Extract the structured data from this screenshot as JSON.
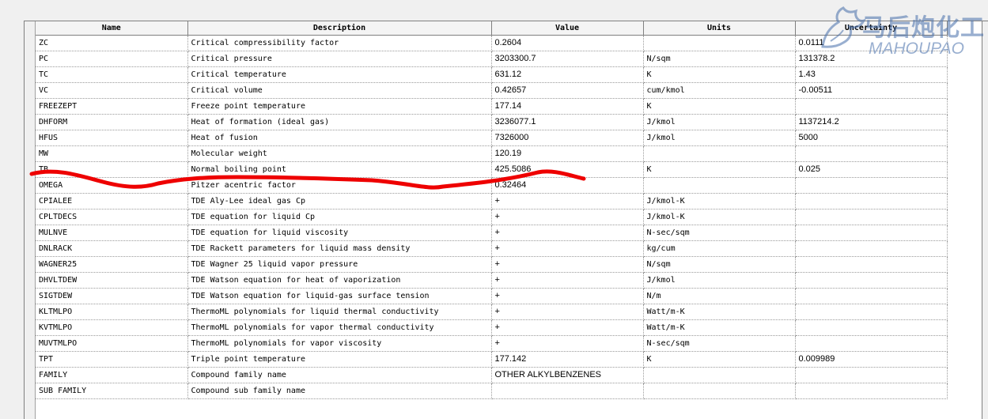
{
  "table": {
    "headers": [
      "Name",
      "Description",
      "Value",
      "Units",
      "Uncertainty"
    ],
    "rows": [
      [
        "ZC",
        "Critical compressibility factor",
        "0.2604",
        "",
        "0.0111"
      ],
      [
        "PC",
        "Critical pressure",
        "3203300.7",
        "N/sqm",
        "131378.2"
      ],
      [
        "TC",
        "Critical temperature",
        "631.12",
        "K",
        "1.43"
      ],
      [
        "VC",
        "Critical volume",
        "0.42657",
        "cum/kmol",
        "-0.00511"
      ],
      [
        "FREEZEPT",
        "Freeze point temperature",
        "177.14",
        "K",
        ""
      ],
      [
        "DHFORM",
        "Heat of formation (ideal gas)",
        "3236077.1",
        "J/kmol",
        "1137214.2"
      ],
      [
        "HFUS",
        "Heat of fusion",
        "7326000",
        "J/kmol",
        "5000"
      ],
      [
        "MW",
        "Molecular weight",
        "120.19",
        "",
        ""
      ],
      [
        "TB",
        "Normal boiling point",
        "425.5086",
        "K",
        "0.025"
      ],
      [
        "OMEGA",
        "Pitzer acentric factor",
        "0.32464",
        "",
        ""
      ],
      [
        "CPIALEE",
        "TDE Aly-Lee ideal gas Cp",
        "+",
        "J/kmol-K",
        ""
      ],
      [
        "CPLTDECS",
        "TDE equation for liquid Cp",
        "+",
        "J/kmol-K",
        ""
      ],
      [
        "MULNVE",
        "TDE equation for liquid viscosity",
        "+",
        "N-sec/sqm",
        ""
      ],
      [
        "DNLRACK",
        "TDE Rackett parameters for liquid mass density",
        "+",
        "kg/cum",
        ""
      ],
      [
        "WAGNER25",
        "TDE Wagner 25 liquid vapor pressure",
        "+",
        "N/sqm",
        ""
      ],
      [
        "DHVLTDEW",
        "TDE Watson equation for heat of vaporization",
        "+",
        "J/kmol",
        ""
      ],
      [
        "SIGTDEW",
        "TDE Watson equation for liquid-gas surface tension",
        "+",
        "N/m",
        ""
      ],
      [
        "KLTMLPO",
        "ThermoML polynomials for liquid thermal conductivity",
        "+",
        "Watt/m-K",
        ""
      ],
      [
        "KVTMLPO",
        "ThermoML polynomials for vapor thermal conductivity",
        "+",
        "Watt/m-K",
        ""
      ],
      [
        "MUVTMLPO",
        "ThermoML polynomials for vapor viscosity",
        "+",
        "N-sec/sqm",
        ""
      ],
      [
        "TPT",
        "Triple point temperature",
        "177.142",
        "K",
        "0.009989"
      ],
      [
        "FAMILY",
        "Compound family name",
        "OTHER ALKYLBENZENES",
        "",
        ""
      ],
      [
        "SUB FAMILY",
        "Compound sub family name",
        "",
        "",
        ""
      ]
    ]
  },
  "watermark": {
    "chinese": "马后炮化工",
    "english": "MAHOUPAO"
  },
  "colors": {
    "annotation": "#ee0000",
    "watermark": "#466eaa"
  }
}
